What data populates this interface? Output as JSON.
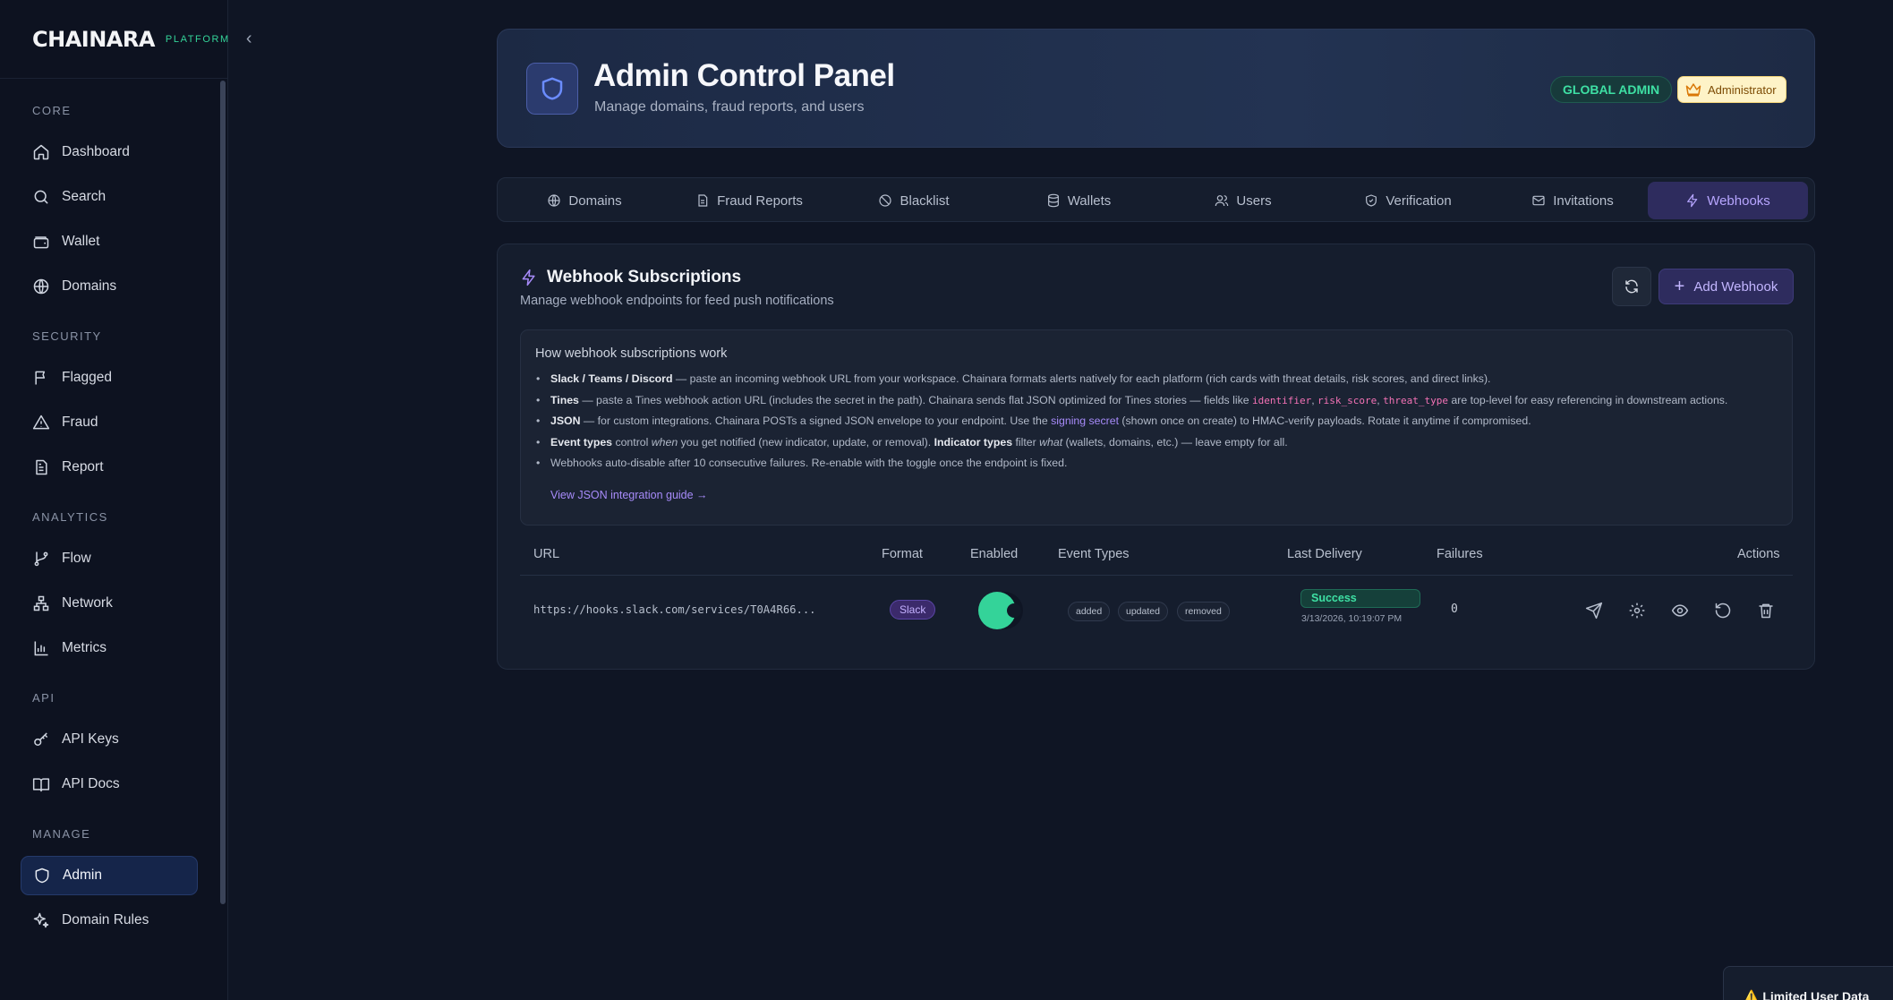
{
  "brand": {
    "logo": "CHAINARA",
    "sub": "PLATFORM"
  },
  "sidebar": {
    "sections": [
      {
        "title": "CORE",
        "items": [
          {
            "label": "Dashboard",
            "icon": "home-icon"
          },
          {
            "label": "Search",
            "icon": "search-icon"
          },
          {
            "label": "Wallet",
            "icon": "wallet-icon"
          },
          {
            "label": "Domains",
            "icon": "globe-icon"
          }
        ]
      },
      {
        "title": "SECURITY",
        "items": [
          {
            "label": "Flagged",
            "icon": "flag-icon"
          },
          {
            "label": "Fraud",
            "icon": "alert-triangle-icon"
          },
          {
            "label": "Report",
            "icon": "file-text-icon"
          }
        ]
      },
      {
        "title": "ANALYTICS",
        "items": [
          {
            "label": "Flow",
            "icon": "git-branch-icon"
          },
          {
            "label": "Network",
            "icon": "network-icon"
          },
          {
            "label": "Metrics",
            "icon": "bar-chart-icon"
          }
        ]
      },
      {
        "title": "API",
        "items": [
          {
            "label": "API Keys",
            "icon": "key-icon"
          },
          {
            "label": "API Docs",
            "icon": "book-open-icon"
          }
        ]
      },
      {
        "title": "MANAGE",
        "items": [
          {
            "label": "Admin",
            "icon": "shield-icon",
            "active": true
          },
          {
            "label": "Domain Rules",
            "icon": "sparkles-icon"
          }
        ]
      }
    ]
  },
  "header": {
    "title": "Admin Control Panel",
    "subtitle": "Manage domains, fraud reports, and users",
    "badge_global": "GLOBAL ADMIN",
    "badge_role": "Administrator"
  },
  "tabs": [
    {
      "label": "Domains",
      "icon": "globe-icon"
    },
    {
      "label": "Fraud Reports",
      "icon": "file-text-icon"
    },
    {
      "label": "Blacklist",
      "icon": "ban-icon"
    },
    {
      "label": "Wallets",
      "icon": "database-icon"
    },
    {
      "label": "Users",
      "icon": "users-icon"
    },
    {
      "label": "Verification",
      "icon": "shield-check-icon"
    },
    {
      "label": "Invitations",
      "icon": "mail-icon"
    },
    {
      "label": "Webhooks",
      "icon": "zap-icon",
      "active": true
    }
  ],
  "webhooks": {
    "title": "Webhook Subscriptions",
    "subtitle": "Manage webhook endpoints for feed push notifications",
    "add_label": "Add Webhook",
    "info": {
      "title": "How webhook subscriptions work",
      "l1_b": "Slack / Teams / Discord",
      "l1": " — paste an incoming webhook URL from your workspace. Chainara formats alerts natively for each platform (rich cards with threat details, risk scores, and direct links).",
      "l2_b": "Tines",
      "l2a": " — paste a Tines webhook action URL (includes the secret in the path). Chainara sends flat JSON optimized for Tines stories — fields like ",
      "l2_c1": "identifier",
      "l2_sep1": ", ",
      "l2_c2": "risk_score",
      "l2_sep2": ", ",
      "l2_c3": "threat_type",
      "l2b": " are top-level for easy referencing in downstream actions.",
      "l3_b": "JSON",
      "l3a": " — for custom integrations. Chainara POSTs a signed JSON envelope to your endpoint. Use the ",
      "l3_link": "signing secret",
      "l3b": " (shown once on create) to HMAC-verify payloads. Rotate it anytime if compromised.",
      "l4_b1": "Event types",
      "l4a": " control ",
      "l4_i1": "when",
      "l4b": " you get notified (new indicator, update, or removal). ",
      "l4_b2": "Indicator types",
      "l4c": " filter ",
      "l4_i2": "what",
      "l4d": " (wallets, domains, etc.) — leave empty for all.",
      "l5": "Webhooks auto-disable after 10 consecutive failures. Re-enable with the toggle once the endpoint is fixed.",
      "guide_link": "View JSON integration guide →"
    },
    "columns": [
      "URL",
      "Format",
      "Enabled",
      "Event Types",
      "Last Delivery",
      "Failures",
      "Actions"
    ],
    "rows": [
      {
        "url": "https://hooks.slack.com/services/T0A4R66...",
        "format": "Slack",
        "enabled": true,
        "events": [
          "added",
          "updated",
          "removed"
        ],
        "status": "Success",
        "delivered": "3/13/2026, 10:19:07 PM",
        "failures": "0"
      }
    ]
  },
  "toast": "⚠️ Limited User Data",
  "colors": {
    "accent": "#a78bfa",
    "success": "#34d399",
    "bg": "#0f1524"
  }
}
